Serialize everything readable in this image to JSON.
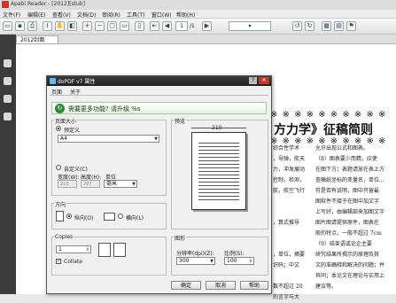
{
  "app": {
    "title": "Apabi Reader - [2012][stub]"
  },
  "menu": [
    "文件(F)",
    "编辑(E)",
    "查看(V)",
    "文档(D)",
    "审阅(R)",
    "工具(T)",
    "窗口(W)",
    "帮助(H)"
  ],
  "toolbar": {
    "page_value": "1",
    "page_total": "/1"
  },
  "tab": {
    "doc_name": "2012封面"
  },
  "doc": {
    "title_part": "方力学》征稿简则",
    "stars": "※ ※ ※ ※ ※ ※ ※ ※ ※ ※",
    "left_col": [
      "综合性学术",
      "，导弹，航天",
      "力，冲发展动",
      "控制，检测，",
      "航，航空飞行",
      "",
      "",
      "，算式推导",
      "",
      "",
      "，单位，摘要",
      "识码；中文",
      "",
      "数不超过 20",
      "的言字与大"
    ],
    "right_col": [
      "允许出现公式和图表。",
      "（8）图表要少而精，应使",
      "在图下方；表题请放在表上方",
      "查稿纸坐标的变量名，单位...",
      "符是否有说明，图中只留最",
      "图软件不接于在图中加文字",
      "上写好，由编辑部来加图文字",
      "图片图请提供原件，图表在",
      "般的特点，一般不超过 7cm",
      "（9）结束语或论企主要",
      "研究结果所揭示的原理及其",
      "文的准确释和解决的问题；并",
      "异同；本论文在理论与实用上",
      "建议等。"
    ]
  },
  "dialog": {
    "title": "doPDF v7 属性",
    "tabs": [
      "页面",
      "关于"
    ],
    "banner": "需要更多功能? 请升级 %s",
    "page_size": {
      "label": "页面大小",
      "predefined_label": "预定义",
      "size_value": "A4",
      "custom_label": "自定义(C)",
      "width_label": "宽度(W):",
      "height_label": "高度(H):",
      "unit_label": "单位",
      "width_value": "210",
      "height_value": "297",
      "unit_value": "毫米"
    },
    "preview": {
      "label": "预览",
      "width_mark": "210"
    },
    "orientation": {
      "label": "方向",
      "portrait": "纵向(O)",
      "landscape": "横向(L)"
    },
    "copies": {
      "label": "Copies",
      "value": "1",
      "collate": "Collate"
    },
    "graphics": {
      "label": "图形",
      "resolution_label": "分辨率(dpi)(Z):",
      "resolution_value": "300",
      "scale_label": "比例(S):",
      "scale_value": "100"
    },
    "buttons": {
      "ok": "确定",
      "cancel": "取消",
      "help": "帮助"
    }
  }
}
